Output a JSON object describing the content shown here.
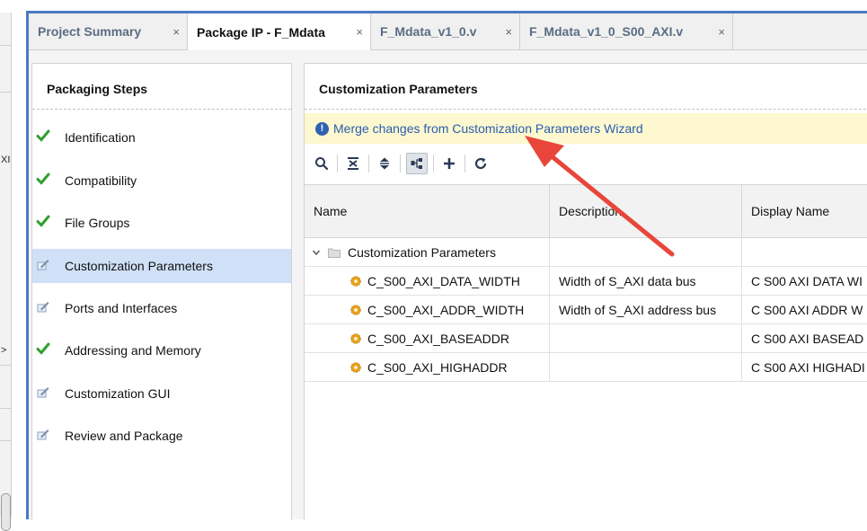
{
  "left_sliver": {
    "fragment_1": "XI",
    "fragment_2": ">"
  },
  "tabs": [
    {
      "label": "Project Summary",
      "close": "×"
    },
    {
      "label": "Package IP - F_Mdata",
      "close": "×"
    },
    {
      "label": "F_Mdata_v1_0.v",
      "close": "×"
    },
    {
      "label": "F_Mdata_v1_0_S00_AXI.v",
      "close": "×"
    }
  ],
  "steps": {
    "title": "Packaging Steps",
    "items": [
      {
        "label": "Identification",
        "status": "check"
      },
      {
        "label": "Compatibility",
        "status": "check"
      },
      {
        "label": "File Groups",
        "status": "check"
      },
      {
        "label": "Customization Parameters",
        "status": "edit",
        "selected": true
      },
      {
        "label": "Ports and Interfaces",
        "status": "edit"
      },
      {
        "label": "Addressing and Memory",
        "status": "check"
      },
      {
        "label": "Customization GUI",
        "status": "edit"
      },
      {
        "label": "Review and Package",
        "status": "edit"
      }
    ]
  },
  "customization": {
    "title": "Customization Parameters",
    "banner_link": "Merge changes from Customization Parameters Wizard",
    "columns": [
      "Name",
      "Description",
      "Display Name"
    ],
    "group": "Customization Parameters",
    "rows": [
      {
        "name": "C_S00_AXI_DATA_WIDTH",
        "description": "Width of S_AXI data bus",
        "display": "C S00 AXI DATA WI"
      },
      {
        "name": "C_S00_AXI_ADDR_WIDTH",
        "description": "Width of S_AXI address bus",
        "display": "C S00 AXI ADDR W"
      },
      {
        "name": "C_S00_AXI_BASEADDR",
        "description": "",
        "display": "C S00 AXI BASEAD"
      },
      {
        "name": "C_S00_AXI_HIGHADDR",
        "description": "",
        "display": "C S00 AXI HIGHADI"
      }
    ]
  },
  "colors": {
    "accent_border": "#4a7ac4",
    "check": "#2ea02e",
    "link": "#2a5db0",
    "banner": "#fdf8cf",
    "selected_row": "#cfe0f7",
    "annotation_arrow": "#e8463a"
  }
}
